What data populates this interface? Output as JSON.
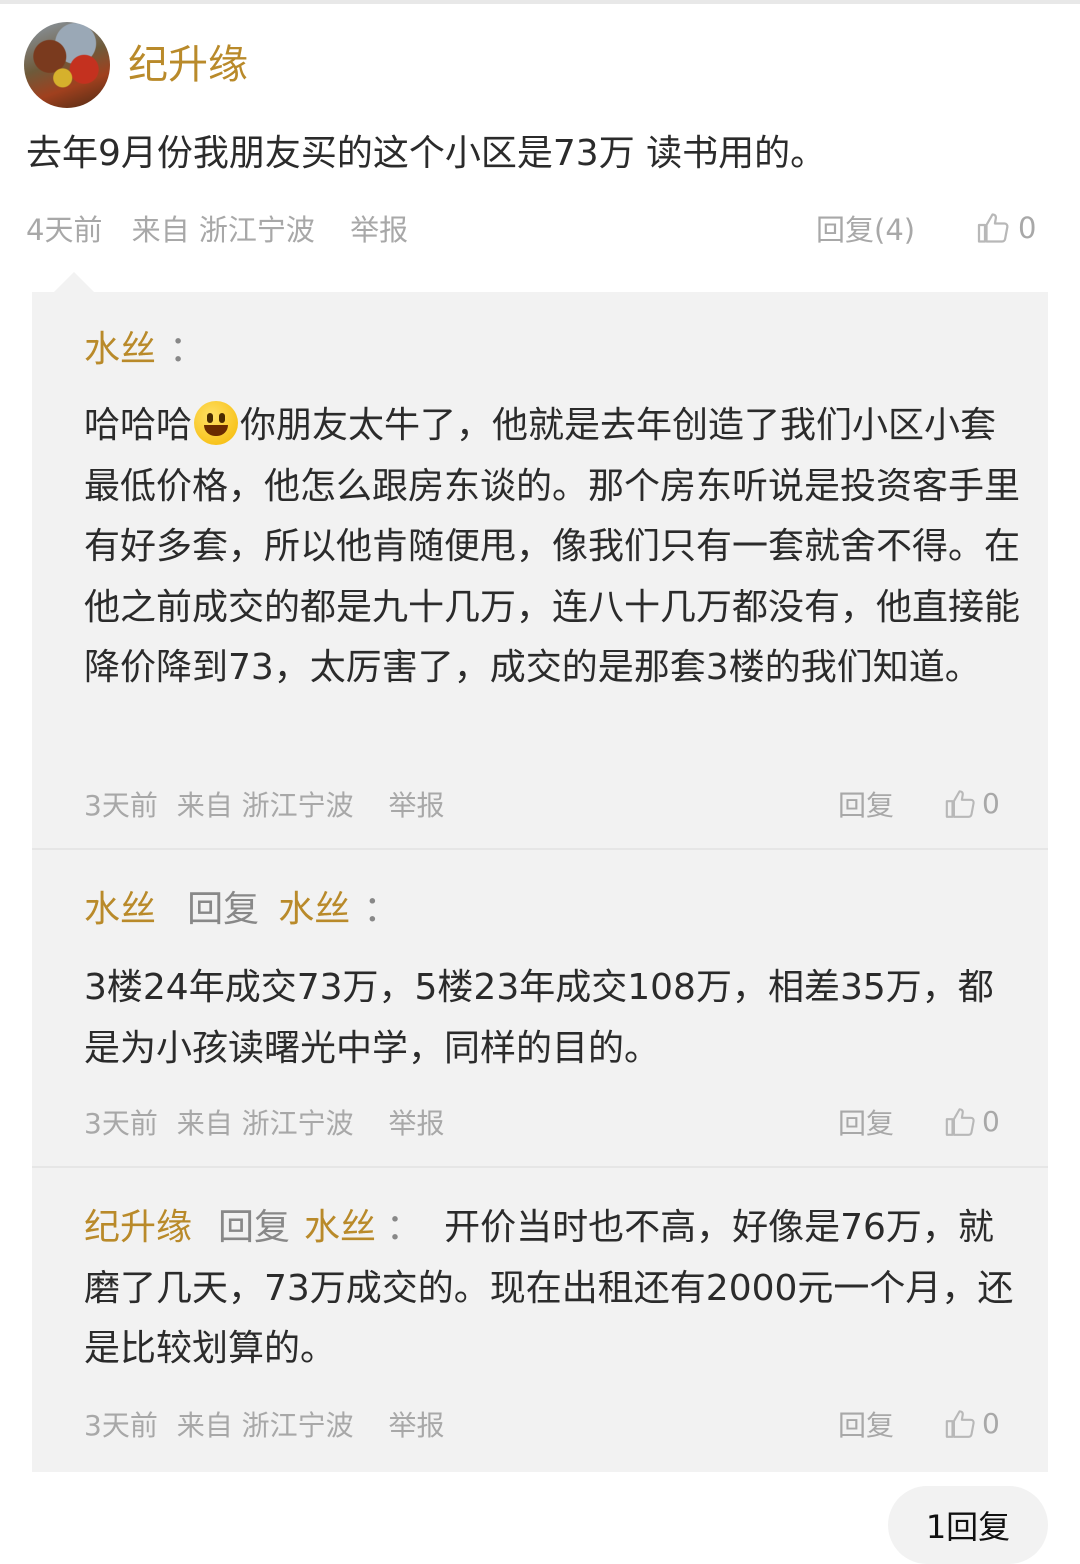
{
  "post": {
    "author": "纪升缘",
    "content": "去年9月份我朋友买的这个小区是73万 读书用的。",
    "time": "4天前",
    "source": "来自 浙江宁波",
    "report": "举报",
    "reply_label": "回复(4)",
    "likes": "0"
  },
  "replies": [
    {
      "author": "水丝",
      "colon": "：",
      "body_prefix": "哈哈哈",
      "emoji": "grinning-face-emoji",
      "body": "你朋友太牛了，他就是去年创造了我们小区小套最低价格，他怎么跟房东谈的。那个房东听说是投资客手里有好多套，所以他肯随便甩，像我们只有一套就舍不得。在他之前成交的都是九十几万，连八十几万都没有，他直接能降价降到73，太厉害了，成交的是那套3楼的我们知道。",
      "time": "3天前",
      "source": "来自 浙江宁波",
      "report": "举报",
      "reply_label": "回复",
      "likes": "0"
    },
    {
      "author": "水丝",
      "reply_word": "回复",
      "target": "水丝",
      "colon": "：",
      "body": "3楼24年成交73万，5楼23年成交108万，相差35万，都是为小孩读曙光中学，同样的目的。",
      "time": "3天前",
      "source": "来自 浙江宁波",
      "report": "举报",
      "reply_label": "回复",
      "likes": "0"
    },
    {
      "author": "纪升缘",
      "reply_word": "回复",
      "target": "水丝",
      "colon": "：",
      "body": "开价当时也不高，好像是76万，就磨了几天，73万成交的。现在出租还有2000元一个月，还是比较划算的。",
      "time": "3天前",
      "source": "来自 浙江宁波",
      "report": "举报",
      "reply_label": "回复",
      "likes": "0"
    }
  ],
  "bottom_button": "1回复",
  "icons": {
    "like": "thumbs-up-icon",
    "avatar": "avatar"
  },
  "colors": {
    "username": "#b98a2a",
    "meta": "#a8a8a8",
    "thread_bg": "#f2f2f2",
    "text": "#2b2b2b"
  }
}
